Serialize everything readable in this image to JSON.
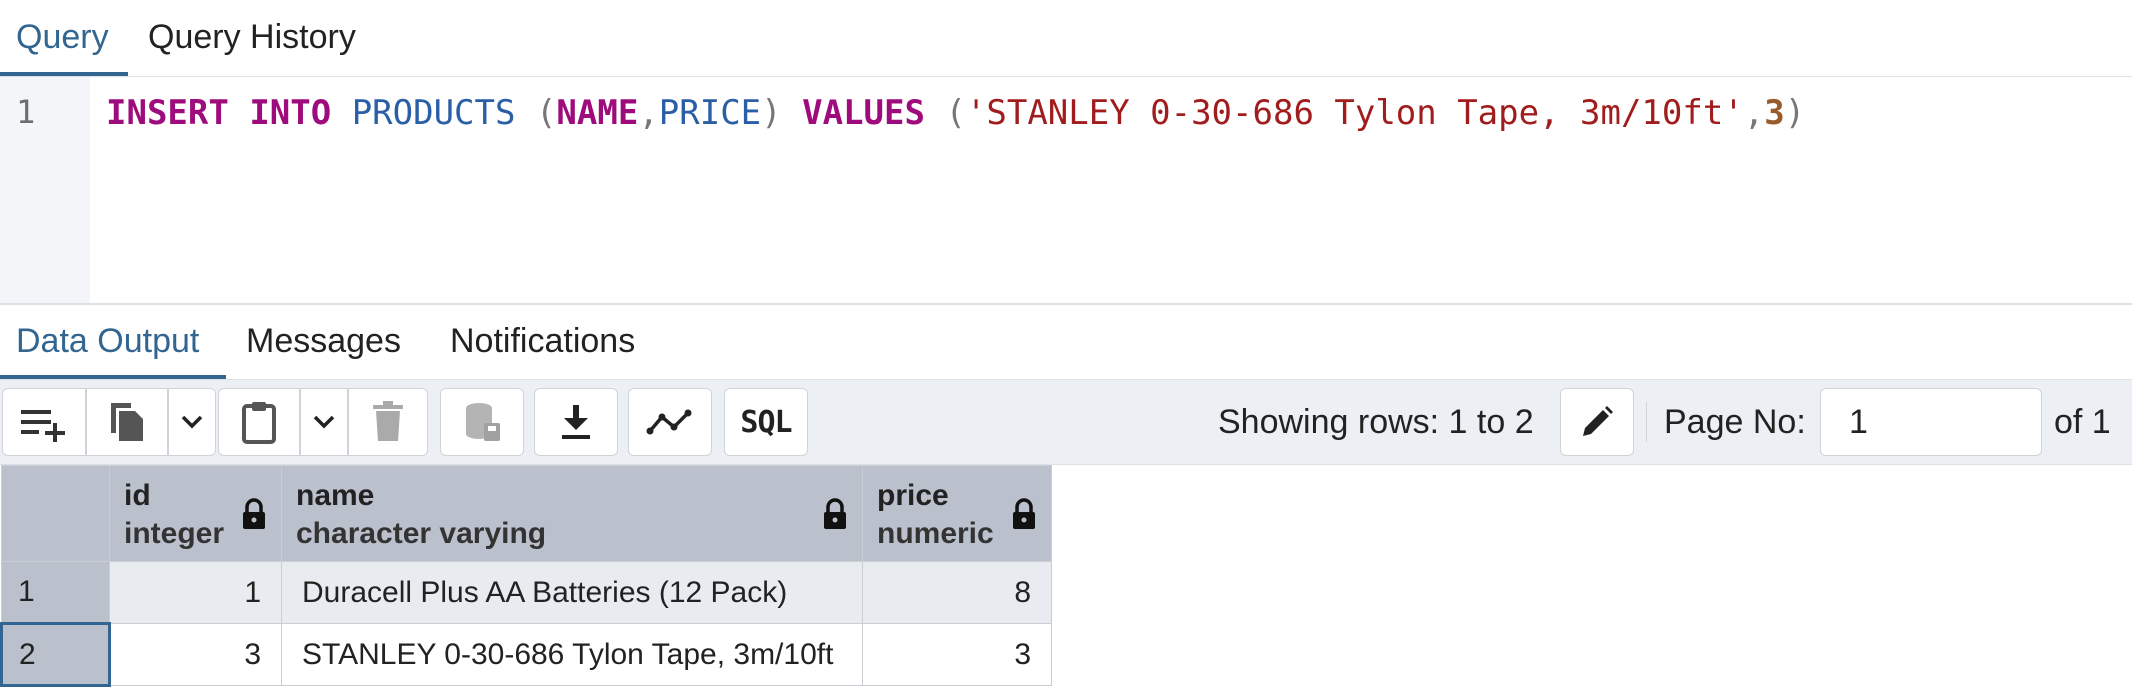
{
  "top_tabs": [
    "Query",
    "Query History"
  ],
  "editor": {
    "line_number": "1",
    "tokens": {
      "insert": "INSERT",
      "into": "INTO",
      "table": "PRODUCTS",
      "open1": "(",
      "col_name": "NAME",
      "comma1": ",",
      "col_price": "PRICE",
      "close1": ")",
      "values": "VALUES",
      "open2": "(",
      "string": "'STANLEY 0-30-686 Tylon Tape, 3m/10ft'",
      "comma2": ",",
      "number": "3",
      "close2": ")"
    }
  },
  "output_tabs": [
    "Data Output",
    "Messages",
    "Notifications"
  ],
  "toolbar": {
    "icons": [
      "add-row-icon",
      "copy-icon",
      "chevron-down-icon",
      "paste-icon",
      "chevron-down-icon",
      "delete-icon",
      "save-data-icon",
      "download-icon",
      "graph-icon"
    ],
    "sql_label": "SQL",
    "status_text": "Showing rows: 1 to 2",
    "page_label": "Page No:",
    "page_value": "1",
    "page_of": "of 1"
  },
  "grid": {
    "columns": [
      {
        "name": "id",
        "type": "integer"
      },
      {
        "name": "name",
        "type": "character varying"
      },
      {
        "name": "price",
        "type": "numeric"
      }
    ],
    "rows": [
      {
        "row": "1",
        "id": "1",
        "name": "Duracell Plus AA Batteries (12 Pack)",
        "price": "8"
      },
      {
        "row": "2",
        "id": "3",
        "name": "STANLEY 0-30-686 Tylon Tape, 3m/10ft",
        "price": "3"
      }
    ]
  },
  "colors": {
    "accent": "#326690",
    "header_bg": "#bac1cd",
    "keyword": "#9e0b7c",
    "identifier": "#2a5fa8",
    "string": "#a11d1d"
  }
}
